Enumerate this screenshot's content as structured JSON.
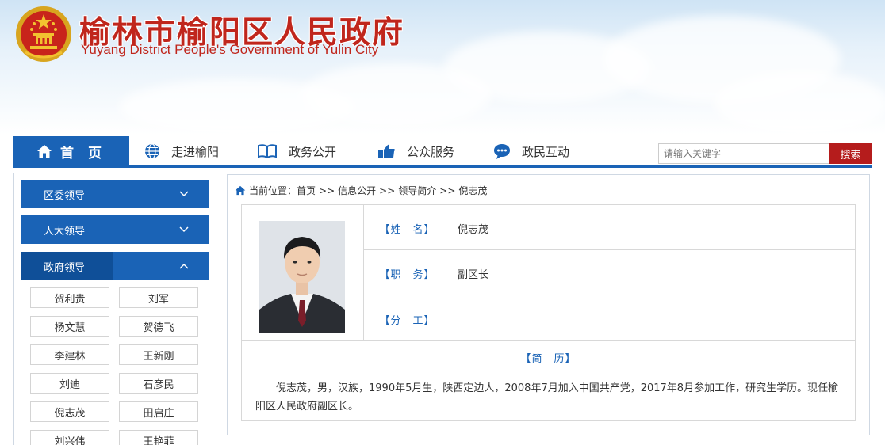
{
  "header": {
    "title": "榆林市榆阳区人民政府",
    "subtitle": "Yuyang District People's Government of Yulin City"
  },
  "nav": {
    "home": "首 页",
    "items": [
      {
        "label": "走进榆阳",
        "icon": "globe-icon"
      },
      {
        "label": "政务公开",
        "icon": "book-icon"
      },
      {
        "label": "公众服务",
        "icon": "hand-pointer-icon"
      },
      {
        "label": "政民互动",
        "icon": "chat-bubble-icon"
      }
    ],
    "search_placeholder": "请输入关键字",
    "search_button": "搜索"
  },
  "sidebar": {
    "sections": [
      {
        "label": "区委领导",
        "expanded": false
      },
      {
        "label": "人大领导",
        "expanded": false
      },
      {
        "label": "政府领导",
        "expanded": true
      }
    ],
    "leaders": [
      "贺利贵",
      "刘军",
      "杨文慧",
      "贺德飞",
      "李建林",
      "王新刚",
      "刘迪",
      "石彦民",
      "倪志茂",
      "田启庄",
      "刘兴伟",
      "王艳菲"
    ]
  },
  "breadcrumb": {
    "prefix": "当前位置：",
    "items": [
      "首页",
      "信息公开",
      "领导简介",
      "倪志茂"
    ],
    "separator": ">>"
  },
  "profile": {
    "name_label": "【姓　名】",
    "name": "倪志茂",
    "position_label": "【职　务】",
    "position": "副区长",
    "duty_label": "【分　工】",
    "duty": "",
    "resume_label": "【简　历】",
    "resume": "倪志茂，男，汉族，1990年5月生，陕西定边人，2008年7月加入中国共产党，2017年8月参加工作，研究生学历。现任榆阳区人民政府副区长。"
  },
  "colors": {
    "brand_blue": "#1a63b6",
    "title_red": "#c0261c",
    "search_red": "#b51c1c"
  }
}
